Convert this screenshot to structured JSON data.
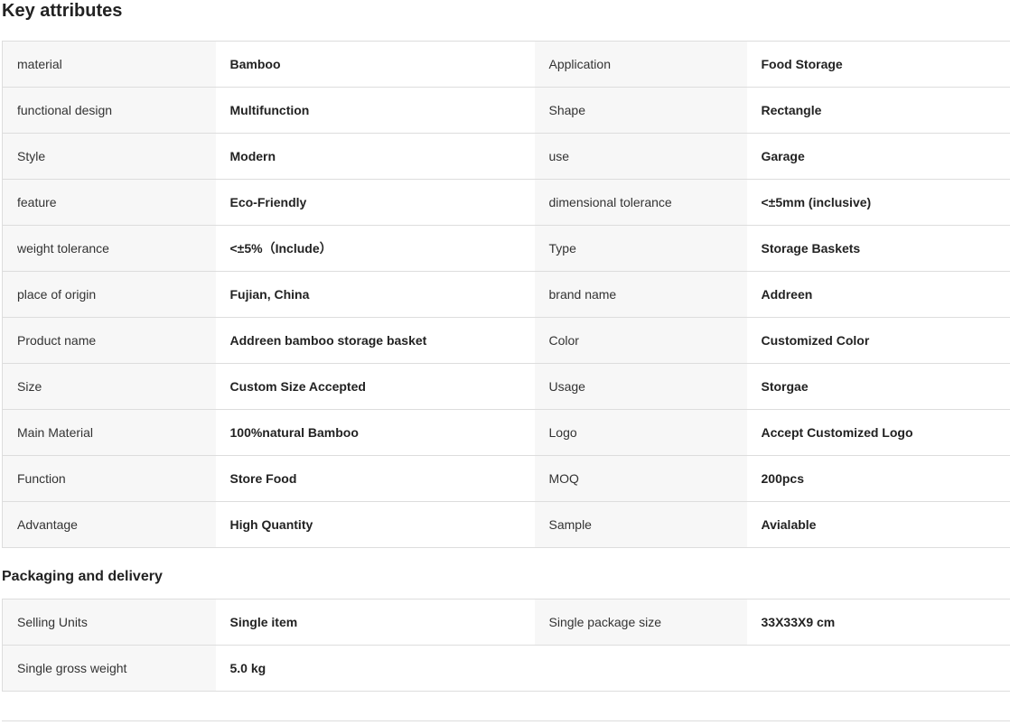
{
  "key_attributes": {
    "title": "Key attributes",
    "rows": [
      {
        "k1": "material",
        "v1": "Bamboo",
        "k2": "Application",
        "v2": "Food Storage"
      },
      {
        "k1": "functional design",
        "v1": "Multifunction",
        "k2": "Shape",
        "v2": "Rectangle"
      },
      {
        "k1": "Style",
        "v1": "Modern",
        "k2": "use",
        "v2": "Garage"
      },
      {
        "k1": "feature",
        "v1": "Eco-Friendly",
        "k2": "dimensional tolerance",
        "v2": "<±5mm (inclusive)"
      },
      {
        "k1": "weight tolerance",
        "v1": "<±5%（Include）",
        "k2": "Type",
        "v2": "Storage Baskets"
      },
      {
        "k1": "place of origin",
        "v1": "Fujian, China",
        "k2": "brand name",
        "v2": "Addreen"
      },
      {
        "k1": "Product name",
        "v1": "Addreen bamboo storage basket",
        "k2": "Color",
        "v2": "Customized Color"
      },
      {
        "k1": "Size",
        "v1": "Custom Size Accepted",
        "k2": "Usage",
        "v2": "Storgae"
      },
      {
        "k1": "Main Material",
        "v1": "100%natural Bamboo",
        "k2": "Logo",
        "v2": "Accept Customized Logo"
      },
      {
        "k1": "Function",
        "v1": "Store Food",
        "k2": "MOQ",
        "v2": "200pcs"
      },
      {
        "k1": "Advantage",
        "v1": "High Quantity",
        "k2": "Sample",
        "v2": "Avialable"
      }
    ]
  },
  "packaging": {
    "title": "Packaging and delivery",
    "rows": [
      {
        "k1": "Selling Units",
        "v1": "Single item",
        "k2": "Single package size",
        "v2": "33X33X9 cm"
      },
      {
        "k1": "Single gross weight",
        "v1": "5.0 kg",
        "k2": "",
        "v2": ""
      }
    ]
  }
}
